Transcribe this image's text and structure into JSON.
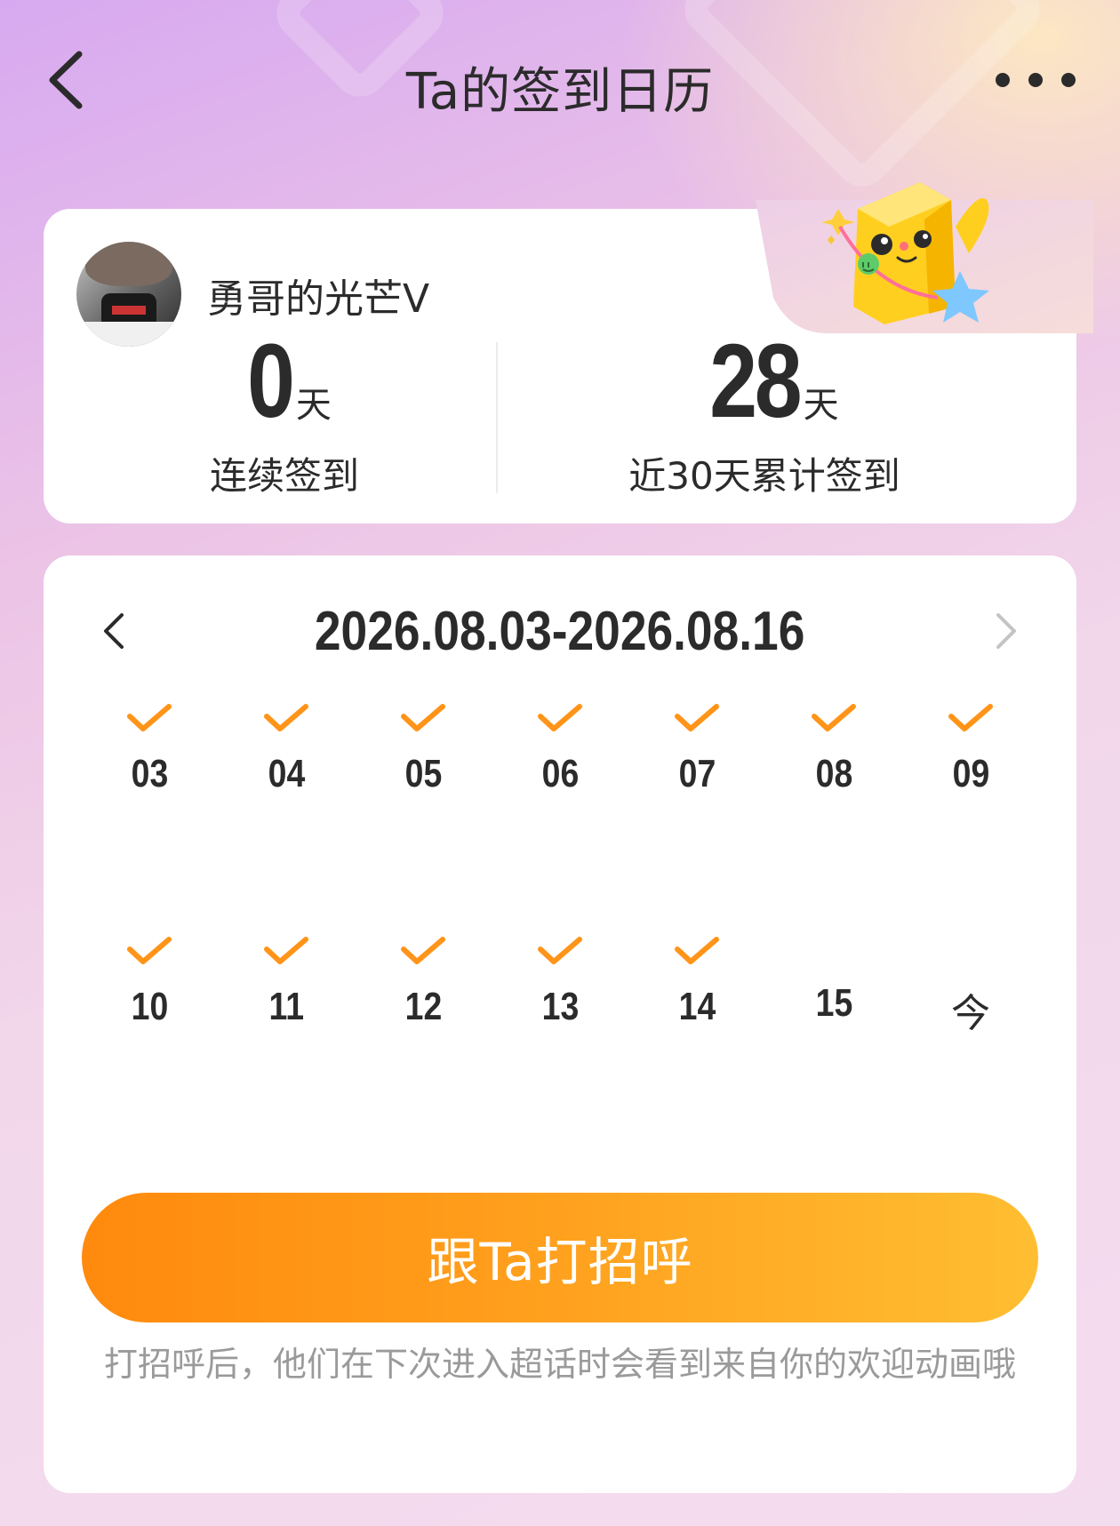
{
  "header": {
    "title": "Ta的签到日历"
  },
  "user": {
    "name": "勇哥的光芒V"
  },
  "stats": {
    "streak": {
      "value": "0",
      "unit": "天",
      "label": "连续签到"
    },
    "total": {
      "value": "28",
      "unit": "天",
      "label": "近30天累计签到"
    }
  },
  "calendar": {
    "range": "2026.08.03-2026.08.16",
    "days": [
      {
        "label": "03",
        "checked": true
      },
      {
        "label": "04",
        "checked": true
      },
      {
        "label": "05",
        "checked": true
      },
      {
        "label": "06",
        "checked": true
      },
      {
        "label": "07",
        "checked": true
      },
      {
        "label": "08",
        "checked": true
      },
      {
        "label": "09",
        "checked": true
      },
      {
        "label": "10",
        "checked": true
      },
      {
        "label": "11",
        "checked": true
      },
      {
        "label": "12",
        "checked": true
      },
      {
        "label": "13",
        "checked": true
      },
      {
        "label": "14",
        "checked": true
      },
      {
        "label": "15",
        "checked": false
      },
      {
        "label": "今",
        "checked": false
      }
    ]
  },
  "action": {
    "button_label": "跟Ta打招呼",
    "hint": "打招呼后，他们在下次进入超话时会看到来自你的欢迎动画哦"
  },
  "colors": {
    "accent": "#ff8a0d",
    "check": "#ff9418",
    "text": "#2b2b2b",
    "hint": "#9a9a9a"
  },
  "icons": {
    "back": "chevron-left-icon",
    "more": "more-dots-icon",
    "prev": "chevron-left-icon",
    "next": "chevron-right-icon",
    "check": "checkmark-icon"
  }
}
